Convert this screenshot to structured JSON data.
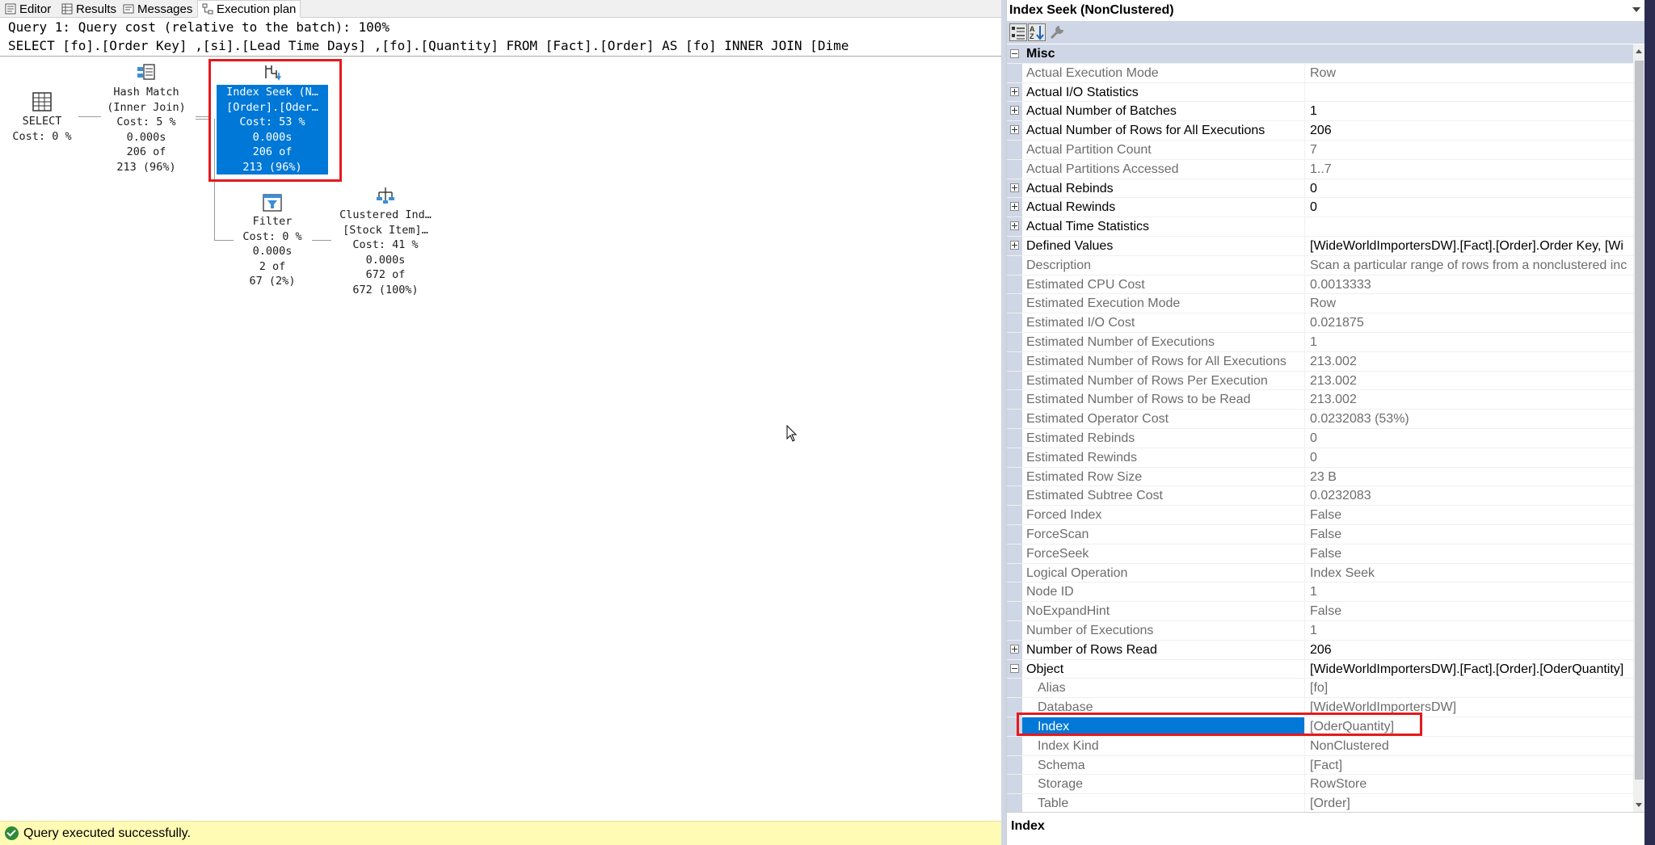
{
  "tabs": [
    {
      "label": "Editor",
      "icon": "editor-icon"
    },
    {
      "label": "Results",
      "icon": "grid-icon"
    },
    {
      "label": "Messages",
      "icon": "messages-icon"
    },
    {
      "label": "Execution plan",
      "icon": "execution-plan-icon",
      "active": true
    }
  ],
  "query": {
    "line1": "Query 1: Query cost (relative to the batch): 100%",
    "line2": "SELECT [fo].[Order Key] ,[si].[Lead Time Days] ,[fo].[Quantity] FROM [Fact].[Order] AS [fo] INNER JOIN [Dime"
  },
  "plan": {
    "select": {
      "l1": "SELECT",
      "l2": "Cost: 0 %",
      "icon": "select-icon"
    },
    "hash_match": {
      "l1": "Hash Match",
      "l2": "(Inner Join)",
      "l3": "Cost: 5 %",
      "l4": "0.000s",
      "l5": "206 of",
      "l6": "213 (96%)",
      "icon": "hash-match-icon"
    },
    "index_seek": {
      "l1": "Index Seek (N…",
      "l2": "[Order].[Oder…",
      "l3": "Cost: 53 %",
      "l4": "0.000s",
      "l5": "206 of",
      "l6": "213 (96%)",
      "icon": "index-seek-icon"
    },
    "filter": {
      "l1": "Filter",
      "l2": "Cost: 0 %",
      "l3": "0.000s",
      "l4": "2 of",
      "l5": "67 (2%)",
      "icon": "filter-icon"
    },
    "clustered": {
      "l1": "Clustered Ind…",
      "l2": "[Stock Item]…",
      "l3": "Cost: 41 %",
      "l4": "0.000s",
      "l5": "672 of",
      "l6": "672 (100%)",
      "icon": "clustered-index-scan-icon"
    }
  },
  "status": {
    "text": "Query executed successfully.",
    "icon": "success-check-icon"
  },
  "properties": {
    "title": "Index Seek (NonClustered)",
    "toolbar": [
      "categorized-icon",
      "alphabetical-icon",
      "property-pages-icon"
    ],
    "rows": [
      {
        "kind": "cat",
        "name": "Misc",
        "expander": "minus"
      },
      {
        "name": "Actual Execution Mode",
        "value": "Row"
      },
      {
        "name": "Actual I/O Statistics",
        "value": "",
        "expander": "plus",
        "bold": true
      },
      {
        "name": "Actual Number of Batches",
        "value": "1",
        "expander": "plus",
        "bold": true
      },
      {
        "name": "Actual Number of Rows for All Executions",
        "value": "206",
        "expander": "plus",
        "bold": true
      },
      {
        "name": "Actual Partition Count",
        "value": "7"
      },
      {
        "name": "Actual Partitions Accessed",
        "value": "1..7"
      },
      {
        "name": "Actual Rebinds",
        "value": "0",
        "expander": "plus",
        "bold": true
      },
      {
        "name": "Actual Rewinds",
        "value": "0",
        "expander": "plus",
        "bold": true
      },
      {
        "name": "Actual Time Statistics",
        "value": "",
        "expander": "plus",
        "bold": true
      },
      {
        "name": "Defined Values",
        "value": "[WideWorldImportersDW].[Fact].[Order].Order Key, [Wi",
        "expander": "plus",
        "bold": true
      },
      {
        "name": "Description",
        "value": "Scan a particular range of rows from a nonclustered inc"
      },
      {
        "name": "Estimated CPU Cost",
        "value": "0.0013333"
      },
      {
        "name": "Estimated Execution Mode",
        "value": "Row"
      },
      {
        "name": "Estimated I/O Cost",
        "value": "0.021875"
      },
      {
        "name": "Estimated Number of Executions",
        "value": "1"
      },
      {
        "name": "Estimated Number of Rows for All Executions",
        "value": "213.002"
      },
      {
        "name": "Estimated Number of Rows Per Execution",
        "value": "213.002"
      },
      {
        "name": "Estimated Number of Rows to be Read",
        "value": "213.002"
      },
      {
        "name": "Estimated Operator Cost",
        "value": "0.0232083 (53%)"
      },
      {
        "name": "Estimated Rebinds",
        "value": "0"
      },
      {
        "name": "Estimated Rewinds",
        "value": "0"
      },
      {
        "name": "Estimated Row Size",
        "value": "23 B"
      },
      {
        "name": "Estimated Subtree Cost",
        "value": "0.0232083"
      },
      {
        "name": "Forced Index",
        "value": "False"
      },
      {
        "name": "ForceScan",
        "value": "False"
      },
      {
        "name": "ForceSeek",
        "value": "False"
      },
      {
        "name": "Logical Operation",
        "value": "Index Seek"
      },
      {
        "name": "Node ID",
        "value": "1"
      },
      {
        "name": "NoExpandHint",
        "value": "False"
      },
      {
        "name": "Number of Executions",
        "value": "1"
      },
      {
        "name": "Number of Rows Read",
        "value": "206",
        "expander": "plus",
        "bold": true
      },
      {
        "name": "Object",
        "value": "[WideWorldImportersDW].[Fact].[Order].[OderQuantity]",
        "expander": "minus",
        "bold": true
      },
      {
        "name": "Alias",
        "value": "[fo]",
        "child": true
      },
      {
        "name": "Database",
        "value": "[WideWorldImportersDW]",
        "child": true
      },
      {
        "name": "Index",
        "value": "[OderQuantity]",
        "child": true,
        "selected": true
      },
      {
        "name": "Index Kind",
        "value": "NonClustered",
        "child": true
      },
      {
        "name": "Schema",
        "value": "[Fact]",
        "child": true
      },
      {
        "name": "Storage",
        "value": "RowStore",
        "child": true
      },
      {
        "name": "Table",
        "value": "[Order]",
        "child": true
      }
    ],
    "description_title": "Index"
  },
  "accent_color": "#0078d7",
  "highlight_color": "#e5191e",
  "status_bg_color": "#fffbb4"
}
